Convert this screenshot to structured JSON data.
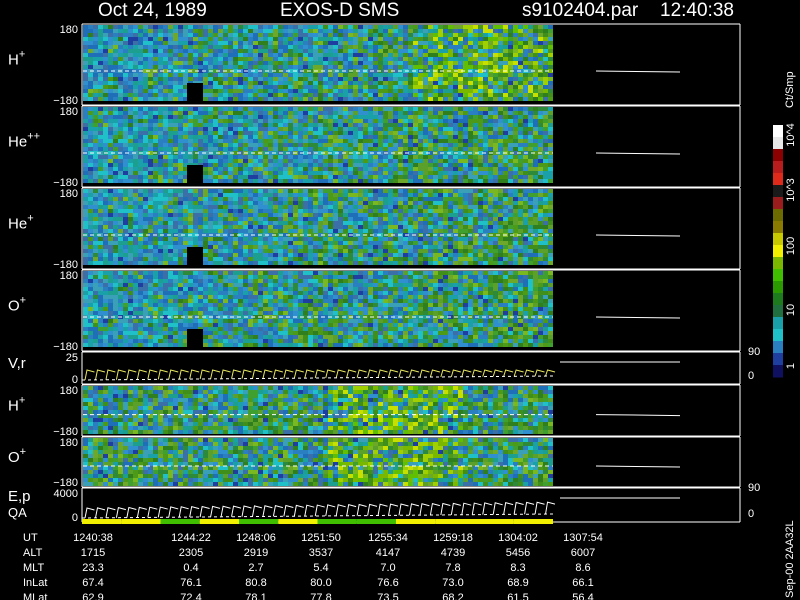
{
  "header": {
    "date": "Oct 24, 1989",
    "instrument": "EXOS-D SMS",
    "file": "s9102404.par",
    "time": "12:40:38"
  },
  "colorbar": {
    "unit": "Ct/Smp",
    "tick_labels": [
      "10^4",
      "10^3",
      "100",
      "10",
      "1"
    ],
    "colors": [
      "#ffffff",
      "#e8e8e8",
      "#8b0000",
      "#b81c1c",
      "#dd2a1a",
      "#1a1a1a",
      "#9a1c1c",
      "#6b6b00",
      "#8b7a00",
      "#c8c800",
      "#f0f000",
      "#7ab800",
      "#3fbf00",
      "#2a9a00",
      "#1d7a1d",
      "#1f6f3f",
      "#1aa0a8",
      "#1fc0c8",
      "#2a7fc0",
      "#1e3fa0",
      "#101060"
    ]
  },
  "panels": [
    {
      "label": "H",
      "superscript": "+",
      "ymax": "180",
      "ymin": "−180",
      "type": "spectrogram"
    },
    {
      "label": "He",
      "superscript": "++",
      "ymax": "180",
      "ymin": "−180",
      "type": "spectrogram"
    },
    {
      "label": "He",
      "superscript": "+",
      "ymax": "180",
      "ymin": "−180",
      "type": "spectrogram"
    },
    {
      "label": "O",
      "superscript": "+",
      "ymax": "180",
      "ymin": "−180",
      "type": "spectrogram"
    },
    {
      "label": "V,r",
      "superscript": "",
      "ymax": "25",
      "ymin": "0",
      "right_max": "90",
      "right_min": "0",
      "type": "line"
    },
    {
      "label": "H",
      "superscript": "+",
      "ymax": "180",
      "ymin": "−180",
      "type": "spectrogram"
    },
    {
      "label": "O",
      "superscript": "+",
      "ymax": "180",
      "ymin": "−180",
      "type": "spectrogram"
    },
    {
      "label": "E,p",
      "label2": "QA",
      "superscript": "",
      "ymax": "4000",
      "ymin": "0",
      "right_max": "90",
      "right_min": "0",
      "type": "line"
    }
  ],
  "table": {
    "rows": [
      {
        "name": "UT",
        "values": [
          "1240:38",
          "1244:22",
          "1248:06",
          "1251:50",
          "1255:34",
          "1259:18",
          "1304:02",
          "1307:54"
        ]
      },
      {
        "name": "ALT",
        "values": [
          "1715",
          "2305",
          "2919",
          "3537",
          "4147",
          "4739",
          "5456",
          "6007"
        ]
      },
      {
        "name": "MLT",
        "values": [
          "23.3",
          "0.4",
          "2.7",
          "5.4",
          "7.0",
          "7.8",
          "8.3",
          "8.6"
        ]
      },
      {
        "name": "InLat",
        "values": [
          "67.4",
          "76.1",
          "80.8",
          "80.0",
          "76.6",
          "73.0",
          "68.9",
          "66.1"
        ]
      },
      {
        "name": "MLat",
        "values": [
          "62.9",
          "72.4",
          "78.1",
          "77.8",
          "73.5",
          "68.2",
          "61.5",
          "56.4"
        ]
      }
    ]
  },
  "footer": {
    "stamp": "Sep-00 2AA32L"
  },
  "chart_data": {
    "type": "heatmap",
    "title": "Oct 24, 1989   EXOS-D SMS   s9102404.par  12:40:38",
    "x": [
      "1240:38",
      "1244:22",
      "1248:06",
      "1251:50",
      "1255:34",
      "1259:18",
      "1304:02",
      "1307:54"
    ],
    "panels": [
      "H+",
      "He++",
      "He+",
      "O+",
      "V,r",
      "H+",
      "O+",
      "E,p QA"
    ],
    "ylim_pitch": [
      -180,
      180
    ],
    "colorbar_range": [
      1,
      10000
    ],
    "colorbar_unit": "Ct/Smp",
    "log_scale": true
  }
}
